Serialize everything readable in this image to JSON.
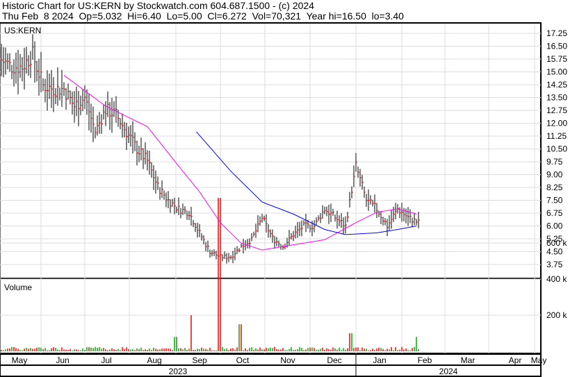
{
  "header": {
    "title": "Historic Chart for US:KERN by Stockwatch.com 604.687.1500 - (c) 2024",
    "quote": "Thu Feb  8 2024  Op=5.032  Hi=6.40  Lo=5.00  Cl=6.272  Vol=70,321  Year hi=16.50  lo=3.40"
  },
  "chart_data": {
    "type": "line",
    "title": "US:KERN",
    "price_panel": {
      "ylim": [
        3.0,
        17.6
      ],
      "yticks": [
        "17.25",
        "16.50",
        "15.75",
        "15.00",
        "14.25",
        "13.50",
        "12.75",
        "12.00",
        "11.25",
        "10.50",
        "9.75",
        "9.00",
        "8.25",
        "7.50",
        "6.75",
        "6.00",
        "5.25",
        "4.50",
        "3.75"
      ],
      "x_unit": "weeks since May 1 2023",
      "weekly_close": [
        15.7,
        15.3,
        15.3,
        16.0,
        14.2,
        14.0,
        14.0,
        13.0,
        13.5,
        11.5,
        12.8,
        12.5,
        11.5,
        10.5,
        9.8,
        8.3,
        7.5,
        7.0,
        6.8,
        5.6,
        4.5,
        4.2,
        4.2,
        4.8,
        5.2,
        6.5,
        5.3,
        4.8,
        5.5,
        6.0,
        6.0,
        7.0,
        6.5,
        6.0,
        9.5,
        7.5,
        7.0,
        6.0,
        7.0,
        6.5,
        6.2
      ],
      "ma_short": [
        [
          6,
          14.8
        ],
        [
          10,
          13.0
        ],
        [
          14,
          11.8
        ],
        [
          17,
          9.5
        ],
        [
          19,
          8.0
        ],
        [
          21,
          6.2
        ],
        [
          23,
          5.0
        ],
        [
          25,
          4.6
        ],
        [
          28,
          4.9
        ],
        [
          31,
          5.2
        ],
        [
          34,
          6.2
        ],
        [
          36,
          6.8
        ],
        [
          38,
          7.0
        ],
        [
          39.8,
          6.7
        ]
      ],
      "ma_long": [
        [
          18.7,
          11.5
        ],
        [
          22,
          9.2
        ],
        [
          25,
          7.4
        ],
        [
          28,
          6.7
        ],
        [
          31,
          5.8
        ],
        [
          33,
          5.5
        ],
        [
          36,
          5.6
        ],
        [
          38,
          5.8
        ],
        [
          39.8,
          6.0
        ]
      ],
      "colors": {
        "ma_short": "#ff00ff",
        "ma_long": "#0000ff",
        "bar": "#000000",
        "close_tick": "#ff0000"
      }
    },
    "volume_panel": {
      "label": "Volume",
      "yticks": [
        "600 k",
        "400 k",
        "200 k"
      ],
      "ylim_k": [
        0,
        800
      ],
      "spikes_k": [
        [
          16.7,
          80
        ],
        [
          18.2,
          200
        ],
        [
          20.9,
          850
        ],
        [
          22.9,
          150
        ],
        [
          33.5,
          100
        ],
        [
          39.8,
          80
        ]
      ],
      "colors": {
        "up": "#00aa00",
        "down": "#ff0000"
      }
    },
    "months": [
      "May",
      "Jun",
      "Jul",
      "Aug",
      "Sep",
      "Oct",
      "Nov",
      "Dec",
      "Jan",
      "Feb",
      "Mar",
      "Apr",
      "May"
    ],
    "years": [
      "2023",
      "2024"
    ]
  }
}
